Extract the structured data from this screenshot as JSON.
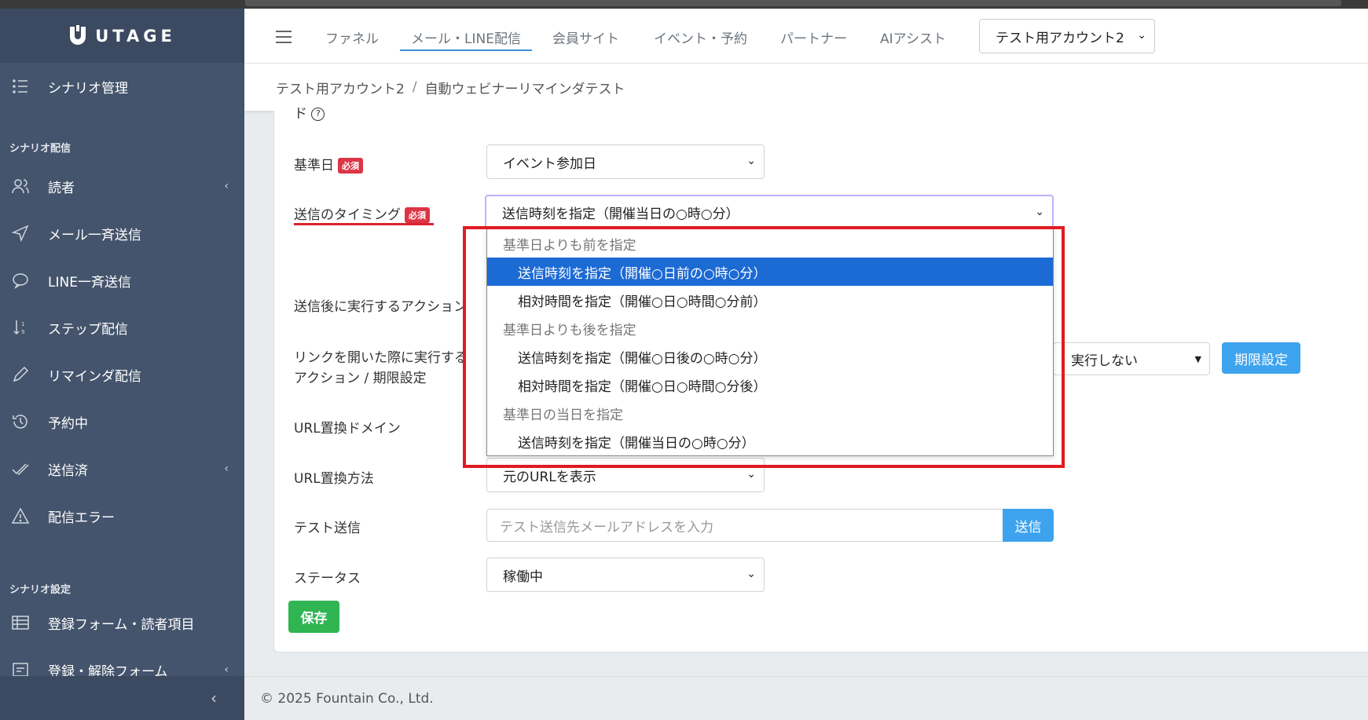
{
  "brand": {
    "name": "UTAGE"
  },
  "sidebar": {
    "top_item": "シナリオ管理",
    "section1": "シナリオ配信",
    "items1": [
      {
        "label": "読者",
        "chevron": "‹"
      },
      {
        "label": "メール一斉送信"
      },
      {
        "label": "LINE一斉送信"
      },
      {
        "label": "ステップ配信"
      },
      {
        "label": "リマインダ配信"
      },
      {
        "label": "予約中"
      },
      {
        "label": "送信済",
        "chevron": "‹"
      },
      {
        "label": "配信エラー"
      }
    ],
    "section2": "シナリオ設定",
    "items2": [
      {
        "label": "登録フォーム・読者項目"
      },
      {
        "label": "登録・解除フォーム",
        "chevron": "‹"
      }
    ],
    "collapse": "‹"
  },
  "header": {
    "nav": [
      "ファネル",
      "メール・LINE配信",
      "会員サイト",
      "イベント・予約",
      "パートナー",
      "AIアシスト"
    ],
    "account": "テスト用アカウント2"
  },
  "breadcrumb": {
    "account": "テスト用アカウント2",
    "separator": "/",
    "page": "自動ウェビナーリマインダテスト"
  },
  "form": {
    "cut_label": "ド",
    "required": "必須",
    "base_date_label": "基準日",
    "base_date_value": "イベント参加日",
    "timing_label": "送信のタイミング",
    "timing_value": "送信時刻を指定（開催当日の○時○分）",
    "after_send_label": "送信後に実行するアクション",
    "link_action_label_1": "リンクを開いた際に実行する",
    "link_action_label_2": "アクション / 期限設定",
    "link_action_value": "実行しない",
    "limit_button": "期限設定",
    "url_domain_label": "URL置換ドメイン",
    "url_method_label": "URL置換方法",
    "url_method_value": "元のURLを表示",
    "test_send_label": "テスト送信",
    "test_send_placeholder": "テスト送信先メールアドレスを入力",
    "send_button": "送信",
    "status_label": "ステータス",
    "status_value": "稼働中",
    "save_button": "保存"
  },
  "dropdown": {
    "rows": [
      {
        "type": "group",
        "label": "基準日よりも前を指定"
      },
      {
        "type": "opt",
        "label": "送信時刻を指定（開催○日前の○時○分）",
        "selected": true
      },
      {
        "type": "opt",
        "label": "相対時間を指定（開催○日○時間○分前）"
      },
      {
        "type": "group",
        "label": "基準日よりも後を指定"
      },
      {
        "type": "opt",
        "label": "送信時刻を指定（開催○日後の○時○分）"
      },
      {
        "type": "opt",
        "label": "相対時間を指定（開催○日○時間○分後）"
      },
      {
        "type": "group",
        "label": "基準日の当日を指定"
      },
      {
        "type": "opt",
        "label": "送信時刻を指定（開催当日の○時○分）"
      }
    ]
  },
  "footer": {
    "copyright": "© 2025 Fountain Co., Ltd."
  },
  "colors": {
    "sidebar": "#44546c",
    "primary": "#3ea3ee",
    "success": "#2fb552",
    "danger": "#dc3545",
    "highlight": "#1c6ad4",
    "annotation": "#e01b22"
  }
}
